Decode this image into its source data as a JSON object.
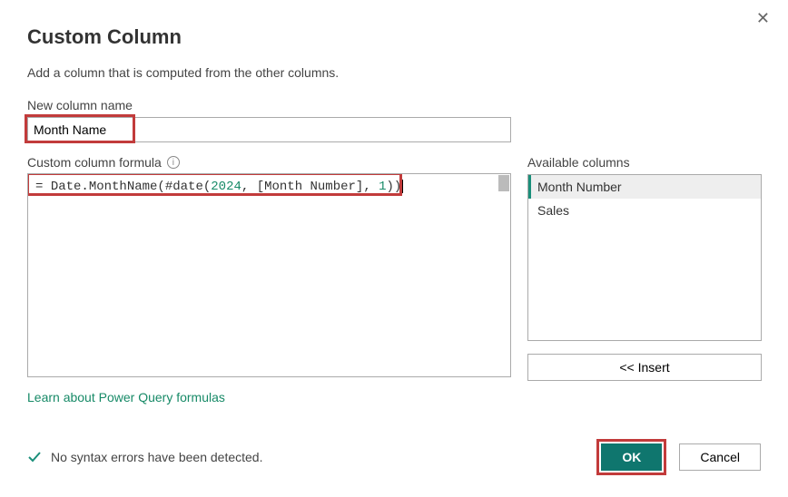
{
  "dialog": {
    "title": "Custom Column",
    "subtitle": "Add a column that is computed from the other columns.",
    "close_label": "✕"
  },
  "new_column": {
    "label": "New column name",
    "value": "Month Name"
  },
  "formula": {
    "label": "Custom column formula",
    "prefix": "= ",
    "fn1": "Date.MonthName(",
    "fn2": "#date(",
    "year": "2024",
    "sep1": ", ",
    "colref": "[Month Number]",
    "sep2": ", ",
    "day": "1",
    "close": "))"
  },
  "available": {
    "label": "Available columns",
    "items": [
      "Month Number",
      "Sales"
    ],
    "insert_label": "<< Insert"
  },
  "learn_link": "Learn about Power Query formulas",
  "status": {
    "text": "No syntax errors have been detected."
  },
  "buttons": {
    "ok": "OK",
    "cancel": "Cancel"
  }
}
